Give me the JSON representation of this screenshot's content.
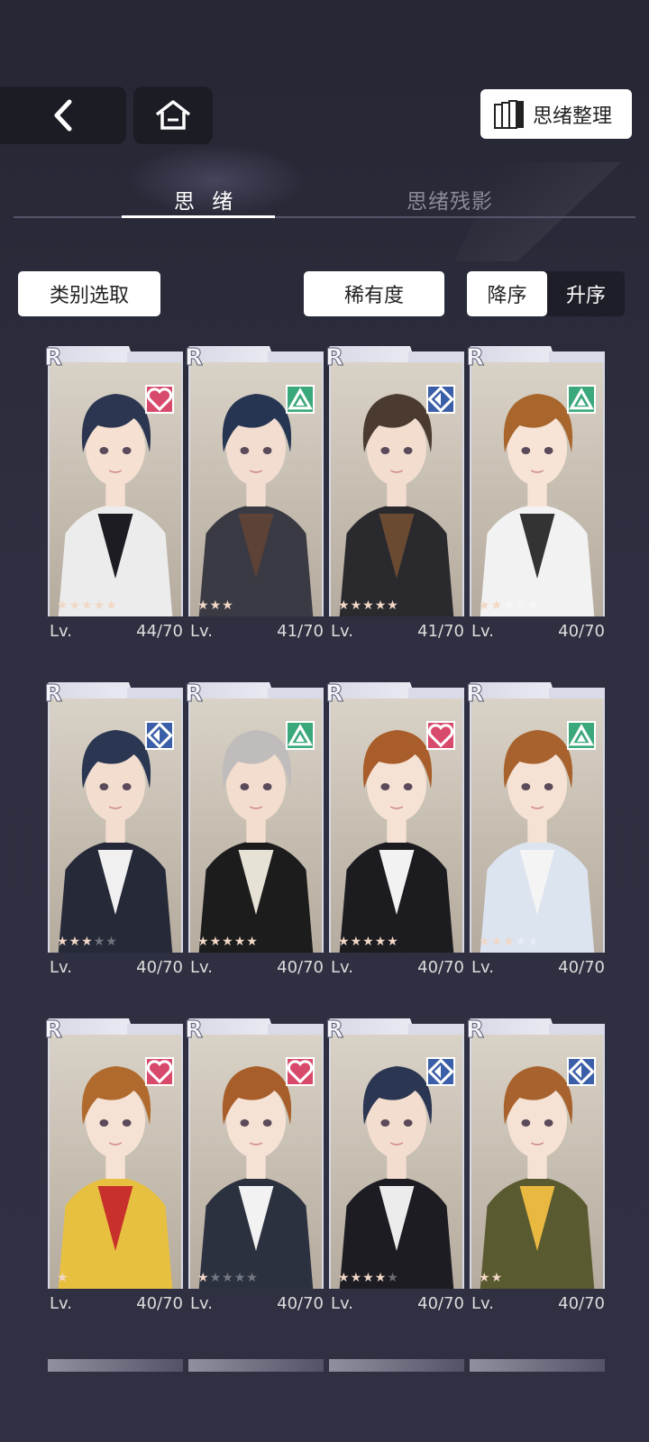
{
  "header": {
    "back_icon": "chevron-left-icon",
    "home_icon": "home-icon",
    "organize_icon": "cards-stack-icon",
    "organize_label": "思绪整理"
  },
  "tabs": [
    {
      "label": "思 绪",
      "active": true
    },
    {
      "label": "思绪残影",
      "active": false
    }
  ],
  "filters": {
    "category_label": "类别选取",
    "rarity_label": "稀有度",
    "sort_desc_label": "降序",
    "sort_asc_label": "升序",
    "sort_selected": "降序"
  },
  "colors": {
    "attr_heart": "#d84a6b",
    "attr_triangle": "#3aa87a",
    "attr_diamond": "#3b5ea8"
  },
  "cards": [
    {
      "rarity": "R",
      "attribute": "heart-icon",
      "stars": 5,
      "max_stars": 5,
      "lv_label": "Lv.",
      "level": "44/70"
    },
    {
      "rarity": "R",
      "attribute": "triangle-icon",
      "stars": 3,
      "max_stars": 3,
      "lv_label": "Lv.",
      "level": "41/70"
    },
    {
      "rarity": "R",
      "attribute": "diamond-icon",
      "stars": 5,
      "max_stars": 5,
      "lv_label": "Lv.",
      "level": "41/70"
    },
    {
      "rarity": "R",
      "attribute": "triangle-icon",
      "stars": 2,
      "max_stars": 5,
      "lv_label": "Lv.",
      "level": "40/70"
    },
    {
      "rarity": "R",
      "attribute": "diamond-icon",
      "stars": 3,
      "max_stars": 5,
      "lv_label": "Lv.",
      "level": "40/70"
    },
    {
      "rarity": "R",
      "attribute": "triangle-icon",
      "stars": 5,
      "max_stars": 5,
      "lv_label": "Lv.",
      "level": "40/70"
    },
    {
      "rarity": "R",
      "attribute": "heart-icon",
      "stars": 5,
      "max_stars": 5,
      "lv_label": "Lv.",
      "level": "40/70"
    },
    {
      "rarity": "R",
      "attribute": "triangle-icon",
      "stars": 3,
      "max_stars": 5,
      "lv_label": "Lv.",
      "level": "40/70"
    },
    {
      "rarity": "R",
      "attribute": "heart-icon",
      "stars": 1,
      "max_stars": 1,
      "lv_label": "Lv.",
      "level": "40/70"
    },
    {
      "rarity": "R",
      "attribute": "heart-icon",
      "stars": 1,
      "max_stars": 5,
      "lv_label": "Lv.",
      "level": "40/70"
    },
    {
      "rarity": "R",
      "attribute": "diamond-icon",
      "stars": 4,
      "max_stars": 5,
      "lv_label": "Lv.",
      "level": "40/70"
    },
    {
      "rarity": "R",
      "attribute": "diamond-icon",
      "stars": 2,
      "max_stars": 2,
      "lv_label": "Lv.",
      "level": "40/70"
    }
  ]
}
